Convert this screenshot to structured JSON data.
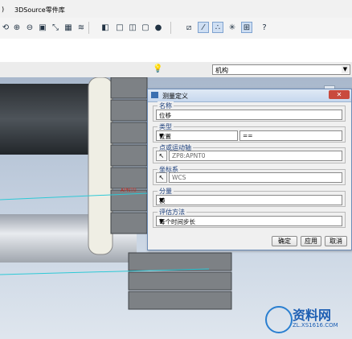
{
  "menubar": {
    "paren": ")",
    "item": "3DSource零件库"
  },
  "toolbar": {
    "icons": [
      "spin-icon",
      "zoom-in-icon",
      "zoom-out-icon",
      "refit-icon",
      "reorient-icon",
      "saved-views-icon",
      "layers-icon",
      "shading-icon",
      "hidden-line-icon",
      "no-hidden-icon",
      "wireframe-icon",
      "appearance-icon",
      "datum-plane-icon",
      "datum-axis-icon",
      "datum-point-icon",
      "coord-sys-icon",
      "context-help-icon"
    ]
  },
  "mechanism_combo": {
    "value": "机构"
  },
  "dialog": {
    "title": "测量定义",
    "close": "✕",
    "name_label": "名称",
    "name_value": "位移",
    "type_label": "类型",
    "type_value": "位置",
    "type_extra": "==",
    "point_label": "点或运动轴",
    "point_value": "ZP8:APNT0",
    "csys_label": "坐标系",
    "csys_value": "WCS",
    "component_label": "分量",
    "component_value": "模",
    "eval_label": "评估方法",
    "eval_value": "每个时间步长",
    "ok": "确定",
    "apply": "应用",
    "cancel": "取消"
  },
  "scene": {
    "point_label": "APNT0"
  },
  "watermark": {
    "title": "资料网",
    "url": "ZL.XS1616.COM"
  }
}
